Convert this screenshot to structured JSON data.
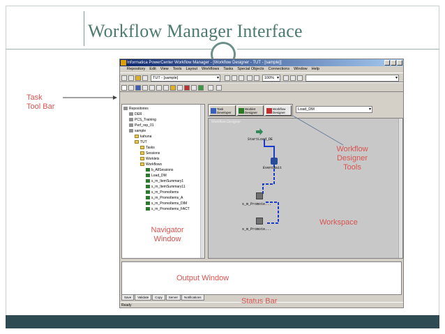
{
  "slide": {
    "title": "Workflow Manager Interface"
  },
  "app": {
    "window_title": "Informatica PowerCenter Workflow Manager - [Workflow Designer - TUT - [sample]]",
    "menu": [
      "Repository",
      "Edit",
      "View",
      "Tools",
      "Layout",
      "Workflows",
      "Tasks",
      "Special Objects",
      "Connections",
      "Window",
      "Help"
    ],
    "folder_combo": "TUT - [sample]",
    "zoom": "100%",
    "designer_tools": [
      {
        "label": "Task Developer"
      },
      {
        "label": "Worklet Designer"
      },
      {
        "label": "Workflow Designer"
      }
    ],
    "workflow_combo": "Load_DM",
    "workspace_label": "Workflow Designer",
    "navigator_items": [
      "Repositories",
      "DER",
      "PCS_Training",
      "Perf_rep_01",
      "sample",
      "kahuna",
      "TUT",
      "Tasks",
      "Sessions",
      "Worklets",
      "Workflows",
      "b_AllSessions",
      "Load_DM",
      "s_m_ItemSummary1",
      "s_m_ItemSummary11",
      "s_m_PromoItems",
      "s_m_PromoItems_A",
      "s_m_PromoItems_DIM",
      "s_m_PromoItems_FACT"
    ],
    "nodes": {
      "start": "StartLoad_DE",
      "wait": "EventWait",
      "session1": "s_m_Promote...",
      "session2": "s_m_Promote..."
    },
    "output_tabs": [
      "Save",
      "Validate",
      "Copy",
      "Server",
      "Notifications"
    ],
    "status": "Ready"
  },
  "annotations": {
    "task_toolbar": "Task\nTool Bar",
    "designer_tools": "Workflow\nDesigner\nTools",
    "workspace": "Workspace",
    "navigator": "Navigator\nWindow",
    "output": "Output Window",
    "status": "Status Bar"
  },
  "colors": {
    "annotation": "#d9534f",
    "title": "#4c7a6f",
    "footer_band": "#2e4a52",
    "link_line": "#1a3acc"
  }
}
